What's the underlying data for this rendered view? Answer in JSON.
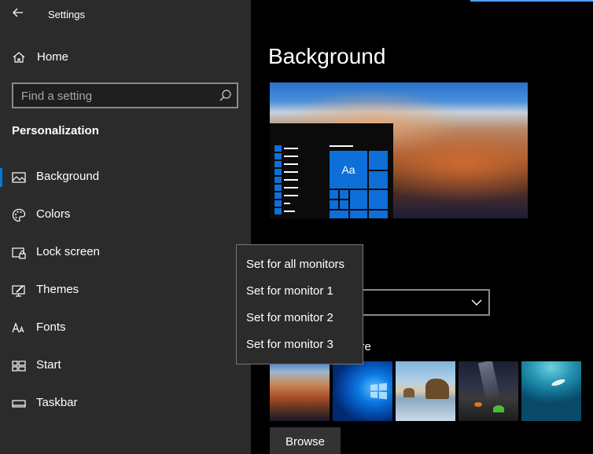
{
  "window": {
    "title": "Settings"
  },
  "sidebar": {
    "home_label": "Home",
    "search_placeholder": "Find a setting",
    "section_title": "Personalization",
    "items": [
      {
        "label": "Background",
        "icon": "picture-icon",
        "active": true
      },
      {
        "label": "Colors",
        "icon": "palette-icon",
        "active": false
      },
      {
        "label": "Lock screen",
        "icon": "lock-screen-icon",
        "active": false
      },
      {
        "label": "Themes",
        "icon": "themes-icon",
        "active": false
      },
      {
        "label": "Fonts",
        "icon": "fonts-icon",
        "active": false
      },
      {
        "label": "Start",
        "icon": "start-icon",
        "active": false
      },
      {
        "label": "Taskbar",
        "icon": "taskbar-icon",
        "active": false
      }
    ]
  },
  "main": {
    "page_title": "Background",
    "preview": {
      "sample_text": "Aa"
    },
    "choose_picture_label_visible": "ture",
    "browse_label": "Browse",
    "thumbnails": [
      {
        "name": "canyon"
      },
      {
        "name": "windows-blue"
      },
      {
        "name": "beach-rock"
      },
      {
        "name": "night-sky-tent"
      },
      {
        "name": "underwater-swimmer"
      }
    ]
  },
  "context_menu": {
    "items": [
      "Set for all monitors",
      "Set for monitor 1",
      "Set for monitor 2",
      "Set for monitor 3"
    ]
  },
  "colors": {
    "accent": "#0078d7",
    "sidebar_bg": "#2b2b2b",
    "main_bg": "#000000",
    "menu_border": "#777777"
  }
}
